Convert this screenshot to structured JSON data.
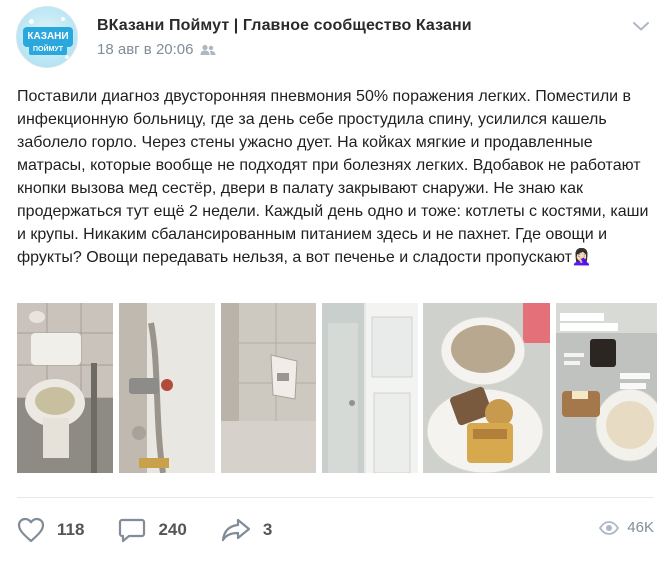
{
  "post": {
    "author": "ВКазани Поймут | Главное сообщество Казани",
    "date": "18 авг в 20:06",
    "avatar_logo": "КАЗАНИ",
    "avatar_logo_sub": "ПОЙМУТ",
    "text": "Поставили диагноз двусторонняя пневмония 50% поражения легких. Поместили в инфекционную больницу, где за день себе простудила спину, усилился кашель заболело горло. Через стены ужасно дует. На койках мягкие и продавленные матрасы, которые вообще не подходят при болезнях легких. Вдобавок не работают кнопки вызова мед сестёр, двери в палату закрывают снаружи. Не знаю как продержаться тут ещё 2 недели. Каждый день одно и тоже: котлеты с костями, каши и крупы. Никаким сбалансированным питанием здесь и не пахнет. Где овощи и фрукты? Овощи передавать нельзя, а вот печенье и сладости пропускают🤦🏻‍♀️"
  },
  "photos": [
    {
      "name": "photo-toilet",
      "icon": "toilet-photo"
    },
    {
      "name": "photo-bathtub",
      "icon": "bathtub-photo"
    },
    {
      "name": "photo-wall-corner",
      "icon": "wall-photo"
    },
    {
      "name": "photo-door",
      "icon": "door-photo"
    },
    {
      "name": "photo-food-tray",
      "icon": "food-photo"
    },
    {
      "name": "photo-breakfast-story",
      "icon": "story-photo"
    }
  ],
  "story_overlay": {
    "line1": "Завтрак",
    "line2": "отвратительно"
  },
  "stats": {
    "likes": "118",
    "comments": "240",
    "shares": "3",
    "views": "46K"
  },
  "colors": {
    "text": "#1f1f1f",
    "muted": "#818c99",
    "action_icon": "#818c99",
    "avatar_blue": "#2aa7dc"
  }
}
